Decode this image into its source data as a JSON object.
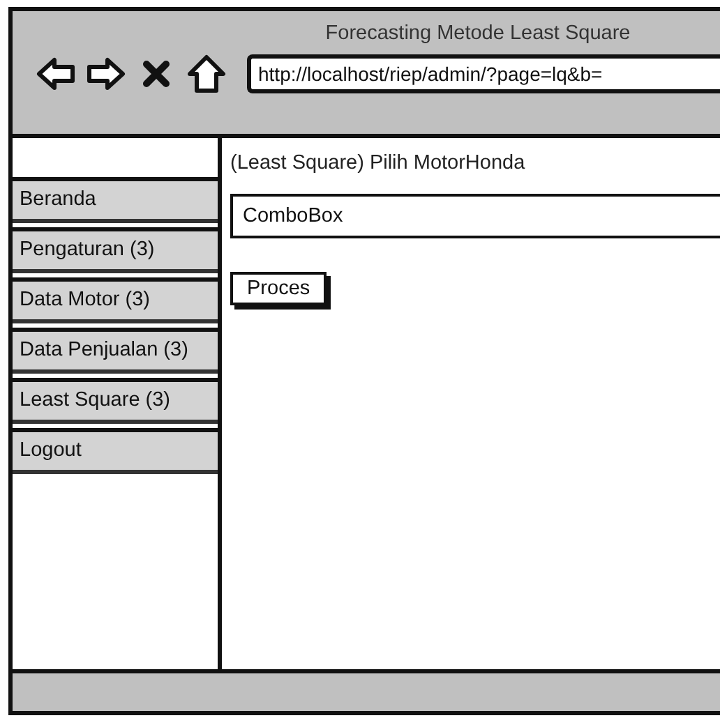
{
  "window": {
    "title": "Forecasting Metode Least Square",
    "url": "http://localhost/riep/admin/?page=lq&b="
  },
  "sidebar": {
    "items": [
      {
        "label": "Beranda"
      },
      {
        "label": "Pengaturan (3)"
      },
      {
        "label": "Data Motor (3)"
      },
      {
        "label": "Data Penjualan (3)"
      },
      {
        "label": "Least Square (3)"
      },
      {
        "label": "Logout"
      }
    ]
  },
  "content": {
    "heading": "(Least Square) Pilih MotorHonda",
    "combo": {
      "value": "ComboBox"
    },
    "button": "Proces"
  }
}
